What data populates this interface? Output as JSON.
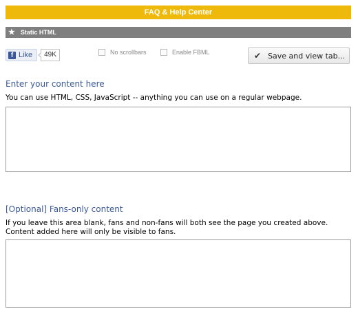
{
  "header": {
    "faq_label": "FAQ & Help Center"
  },
  "section": {
    "title": "Static HTML",
    "icon": "star-icon"
  },
  "toolbar": {
    "like_label": "Like",
    "like_count": "49K",
    "no_scrollbars_label": "No scrollbars",
    "no_scrollbars_checked": false,
    "enable_fbml_label": "Enable FBML",
    "enable_fbml_checked": false,
    "save_label": "Save and view tab..."
  },
  "main_content": {
    "heading": "Enter your content here",
    "description": "You can use HTML, CSS, JavaScript -- anything you can use on a regular webpage.",
    "value": ""
  },
  "fans_content": {
    "heading": "[Optional] Fans-only content",
    "description": "If you leave this area blank, fans and non-fans will both see the page you created above. Content added here will only be visible to fans.",
    "value": ""
  },
  "colors": {
    "header_bar": "#efb90c",
    "section_bar": "#7f7f7f",
    "heading_text": "#3b5998"
  }
}
